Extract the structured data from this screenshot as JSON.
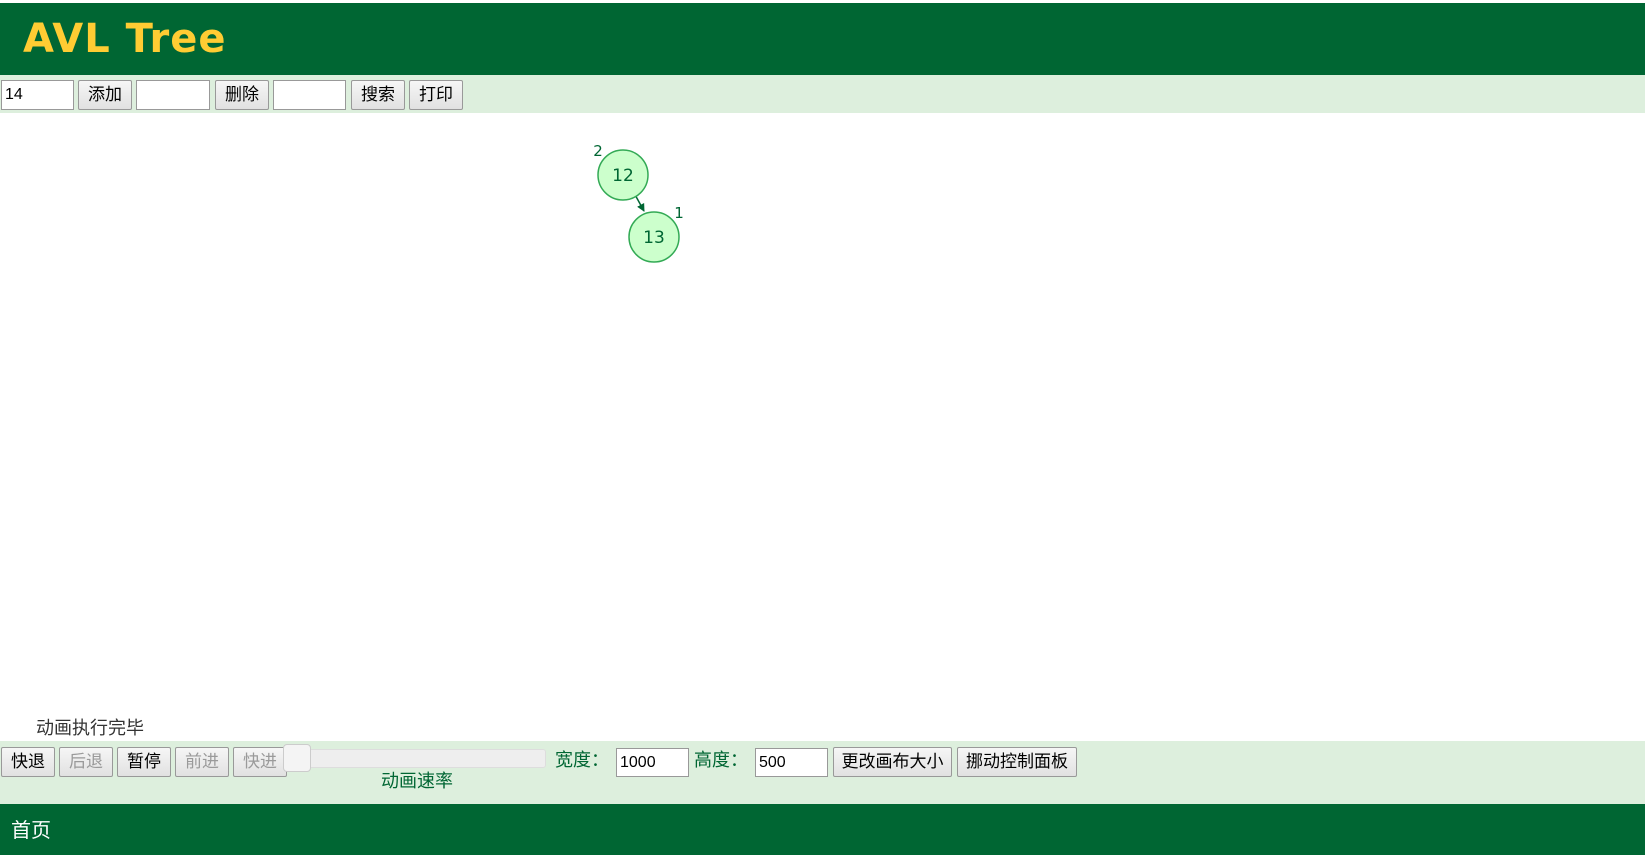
{
  "header": {
    "title": "AVL Tree"
  },
  "toolbar": {
    "insert_value": "14",
    "insert_label": "添加",
    "delete_value": "",
    "delete_label": "删除",
    "search_value": "",
    "search_label": "搜索",
    "print_label": "打印"
  },
  "tree": {
    "nodes": [
      {
        "value": "12",
        "height": "2"
      },
      {
        "value": "13",
        "height": "1"
      }
    ],
    "colors": {
      "fill": "#ccffcc",
      "stroke": "#33aa55",
      "text": "#006633"
    }
  },
  "status": {
    "text": "动画执行完毕"
  },
  "animation": {
    "skip_back_label": "快退",
    "step_back_label": "后退",
    "pause_label": "暂停",
    "step_forward_label": "前进",
    "skip_forward_label": "快进",
    "speed_label": "动画速率",
    "width_label": "宽度：",
    "width_value": "1000",
    "height_label": "高度：",
    "height_value": "500",
    "resize_label": "更改画布大小",
    "move_panel_label": "挪动控制面板"
  },
  "nav": {
    "home_label": "首页"
  },
  "colors": {
    "brand": "#006633",
    "title": "#ffcc33",
    "panel": "#ddefdd"
  }
}
